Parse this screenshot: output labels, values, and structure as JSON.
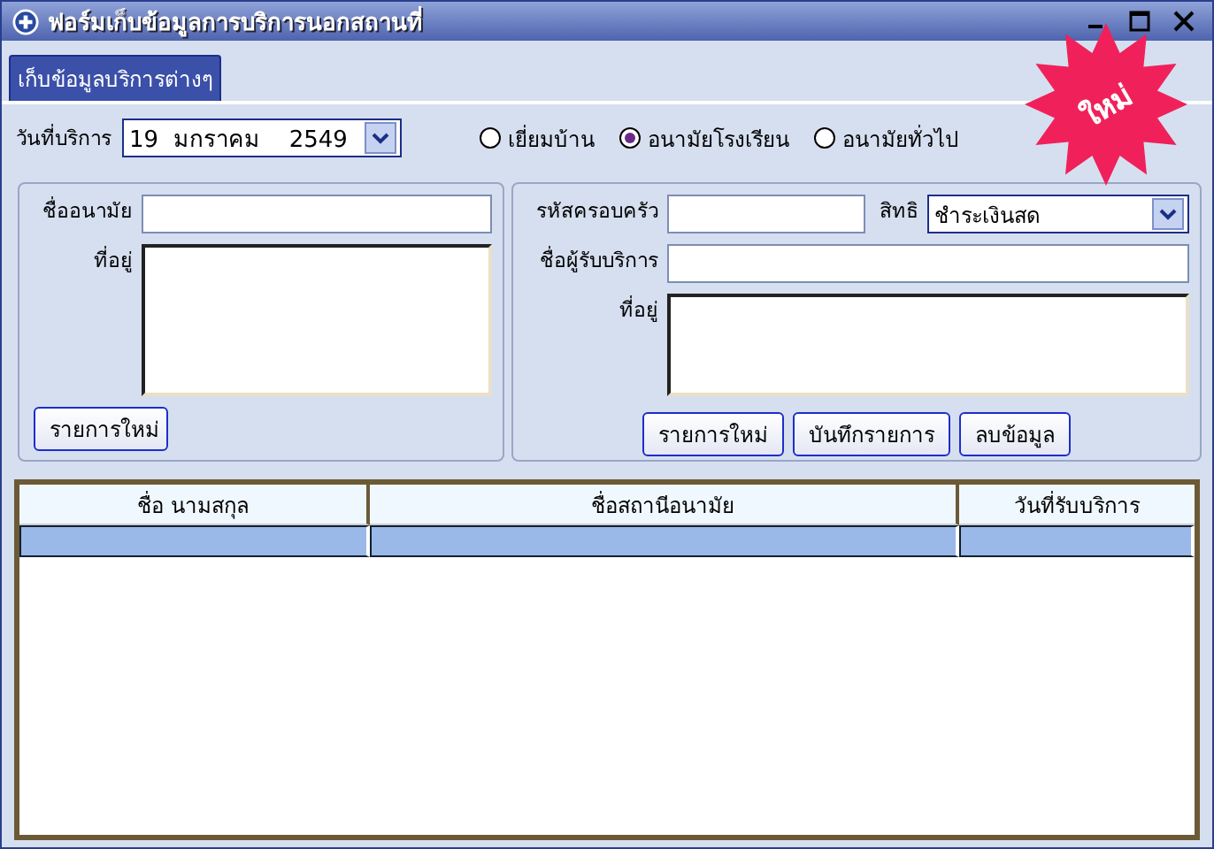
{
  "window": {
    "title": "ฟอร์มเก็บข้อมูลการบริการนอกสถานที่"
  },
  "badge": "ใหม่",
  "tabs": [
    {
      "label": "เก็บข้อมูลบริการต่างๆ",
      "selected": true
    }
  ],
  "service_date": {
    "label": "วันที่บริการ",
    "value": "19  มกราคม    2549"
  },
  "service_types": [
    {
      "label": "เยี่ยมบ้าน",
      "selected": false
    },
    {
      "label": "อนามัยโรงเรียน",
      "selected": true
    },
    {
      "label": "อนามัยทั่วไป",
      "selected": false
    }
  ],
  "clinic": {
    "name_label": "ชื่ออนามัย",
    "address_label": "ที่อยู่",
    "new_button": "รายการใหม่"
  },
  "recipient": {
    "family_code_label": "รหัสครอบครัว",
    "rights_label": "สิทธิ",
    "rights_value": "ชำระเงินสด",
    "name_label": "ชื่อผู้รับบริการ",
    "address_label": "ที่อยู่",
    "buttons": [
      "รายการใหม่",
      "บันทึกรายการ",
      "ลบข้อมูล"
    ]
  },
  "table": {
    "columns": [
      "ชื่อ นามสกุล",
      "ชื่อสถานีอนามัย",
      "วันที่รับบริการ"
    ],
    "rows": [
      {
        "selected": true
      }
    ]
  }
}
